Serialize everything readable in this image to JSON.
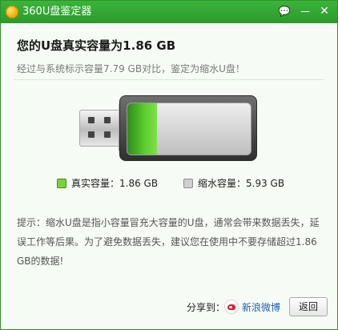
{
  "window": {
    "title": "360U盘鉴定器",
    "controls": {
      "feedback": "💬",
      "minimize": "—",
      "close": "✕"
    }
  },
  "result": {
    "headline": "您的U盘真实容量为1.86 GB",
    "subline": "经过与系统标示容量7.79 GB对比，鉴定为缩水U盘！"
  },
  "usb": {
    "real_fraction": 0.239,
    "colors": {
      "real": "#5ccf2d",
      "shrink": "#cfcfcf"
    }
  },
  "legend": {
    "real": "真实容量：1.86 GB",
    "shrink": "缩水容量：5.93 GB"
  },
  "tip": "提示：缩水U盘是指小容量冒充大容量的U盘，通常会带来数据丢失，延误工作等后果。为了避免数据丢失，建议您在使用中不要存储超过1.86 GB的数据!",
  "footer": {
    "share_label": "分享到：",
    "weibo_label": "新浪微博",
    "back_button": "返回"
  }
}
